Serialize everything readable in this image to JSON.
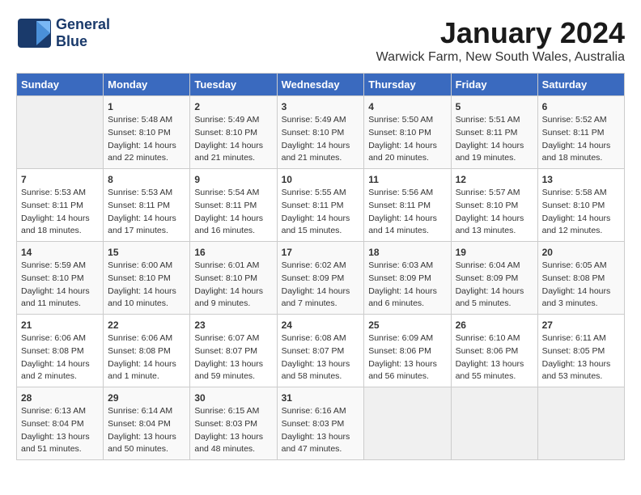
{
  "logo": {
    "line1": "General",
    "line2": "Blue"
  },
  "title": "January 2024",
  "subtitle": "Warwick Farm, New South Wales, Australia",
  "days_of_week": [
    "Sunday",
    "Monday",
    "Tuesday",
    "Wednesday",
    "Thursday",
    "Friday",
    "Saturday"
  ],
  "weeks": [
    [
      {
        "day": "",
        "sunrise": "",
        "sunset": "",
        "daylight": "",
        "empty": true
      },
      {
        "day": "1",
        "sunrise": "Sunrise: 5:48 AM",
        "sunset": "Sunset: 8:10 PM",
        "daylight": "Daylight: 14 hours and 22 minutes."
      },
      {
        "day": "2",
        "sunrise": "Sunrise: 5:49 AM",
        "sunset": "Sunset: 8:10 PM",
        "daylight": "Daylight: 14 hours and 21 minutes."
      },
      {
        "day": "3",
        "sunrise": "Sunrise: 5:49 AM",
        "sunset": "Sunset: 8:10 PM",
        "daylight": "Daylight: 14 hours and 21 minutes."
      },
      {
        "day": "4",
        "sunrise": "Sunrise: 5:50 AM",
        "sunset": "Sunset: 8:10 PM",
        "daylight": "Daylight: 14 hours and 20 minutes."
      },
      {
        "day": "5",
        "sunrise": "Sunrise: 5:51 AM",
        "sunset": "Sunset: 8:11 PM",
        "daylight": "Daylight: 14 hours and 19 minutes."
      },
      {
        "day": "6",
        "sunrise": "Sunrise: 5:52 AM",
        "sunset": "Sunset: 8:11 PM",
        "daylight": "Daylight: 14 hours and 18 minutes."
      }
    ],
    [
      {
        "day": "7",
        "sunrise": "Sunrise: 5:53 AM",
        "sunset": "Sunset: 8:11 PM",
        "daylight": "Daylight: 14 hours and 18 minutes."
      },
      {
        "day": "8",
        "sunrise": "Sunrise: 5:53 AM",
        "sunset": "Sunset: 8:11 PM",
        "daylight": "Daylight: 14 hours and 17 minutes."
      },
      {
        "day": "9",
        "sunrise": "Sunrise: 5:54 AM",
        "sunset": "Sunset: 8:11 PM",
        "daylight": "Daylight: 14 hours and 16 minutes."
      },
      {
        "day": "10",
        "sunrise": "Sunrise: 5:55 AM",
        "sunset": "Sunset: 8:11 PM",
        "daylight": "Daylight: 14 hours and 15 minutes."
      },
      {
        "day": "11",
        "sunrise": "Sunrise: 5:56 AM",
        "sunset": "Sunset: 8:11 PM",
        "daylight": "Daylight: 14 hours and 14 minutes."
      },
      {
        "day": "12",
        "sunrise": "Sunrise: 5:57 AM",
        "sunset": "Sunset: 8:10 PM",
        "daylight": "Daylight: 14 hours and 13 minutes."
      },
      {
        "day": "13",
        "sunrise": "Sunrise: 5:58 AM",
        "sunset": "Sunset: 8:10 PM",
        "daylight": "Daylight: 14 hours and 12 minutes."
      }
    ],
    [
      {
        "day": "14",
        "sunrise": "Sunrise: 5:59 AM",
        "sunset": "Sunset: 8:10 PM",
        "daylight": "Daylight: 14 hours and 11 minutes."
      },
      {
        "day": "15",
        "sunrise": "Sunrise: 6:00 AM",
        "sunset": "Sunset: 8:10 PM",
        "daylight": "Daylight: 14 hours and 10 minutes."
      },
      {
        "day": "16",
        "sunrise": "Sunrise: 6:01 AM",
        "sunset": "Sunset: 8:10 PM",
        "daylight": "Daylight: 14 hours and 9 minutes."
      },
      {
        "day": "17",
        "sunrise": "Sunrise: 6:02 AM",
        "sunset": "Sunset: 8:09 PM",
        "daylight": "Daylight: 14 hours and 7 minutes."
      },
      {
        "day": "18",
        "sunrise": "Sunrise: 6:03 AM",
        "sunset": "Sunset: 8:09 PM",
        "daylight": "Daylight: 14 hours and 6 minutes."
      },
      {
        "day": "19",
        "sunrise": "Sunrise: 6:04 AM",
        "sunset": "Sunset: 8:09 PM",
        "daylight": "Daylight: 14 hours and 5 minutes."
      },
      {
        "day": "20",
        "sunrise": "Sunrise: 6:05 AM",
        "sunset": "Sunset: 8:08 PM",
        "daylight": "Daylight: 14 hours and 3 minutes."
      }
    ],
    [
      {
        "day": "21",
        "sunrise": "Sunrise: 6:06 AM",
        "sunset": "Sunset: 8:08 PM",
        "daylight": "Daylight: 14 hours and 2 minutes."
      },
      {
        "day": "22",
        "sunrise": "Sunrise: 6:06 AM",
        "sunset": "Sunset: 8:08 PM",
        "daylight": "Daylight: 14 hours and 1 minute."
      },
      {
        "day": "23",
        "sunrise": "Sunrise: 6:07 AM",
        "sunset": "Sunset: 8:07 PM",
        "daylight": "Daylight: 13 hours and 59 minutes."
      },
      {
        "day": "24",
        "sunrise": "Sunrise: 6:08 AM",
        "sunset": "Sunset: 8:07 PM",
        "daylight": "Daylight: 13 hours and 58 minutes."
      },
      {
        "day": "25",
        "sunrise": "Sunrise: 6:09 AM",
        "sunset": "Sunset: 8:06 PM",
        "daylight": "Daylight: 13 hours and 56 minutes."
      },
      {
        "day": "26",
        "sunrise": "Sunrise: 6:10 AM",
        "sunset": "Sunset: 8:06 PM",
        "daylight": "Daylight: 13 hours and 55 minutes."
      },
      {
        "day": "27",
        "sunrise": "Sunrise: 6:11 AM",
        "sunset": "Sunset: 8:05 PM",
        "daylight": "Daylight: 13 hours and 53 minutes."
      }
    ],
    [
      {
        "day": "28",
        "sunrise": "Sunrise: 6:13 AM",
        "sunset": "Sunset: 8:04 PM",
        "daylight": "Daylight: 13 hours and 51 minutes."
      },
      {
        "day": "29",
        "sunrise": "Sunrise: 6:14 AM",
        "sunset": "Sunset: 8:04 PM",
        "daylight": "Daylight: 13 hours and 50 minutes."
      },
      {
        "day": "30",
        "sunrise": "Sunrise: 6:15 AM",
        "sunset": "Sunset: 8:03 PM",
        "daylight": "Daylight: 13 hours and 48 minutes."
      },
      {
        "day": "31",
        "sunrise": "Sunrise: 6:16 AM",
        "sunset": "Sunset: 8:03 PM",
        "daylight": "Daylight: 13 hours and 47 minutes."
      },
      {
        "day": "",
        "sunrise": "",
        "sunset": "",
        "daylight": "",
        "empty": true
      },
      {
        "day": "",
        "sunrise": "",
        "sunset": "",
        "daylight": "",
        "empty": true
      },
      {
        "day": "",
        "sunrise": "",
        "sunset": "",
        "daylight": "",
        "empty": true
      }
    ]
  ]
}
